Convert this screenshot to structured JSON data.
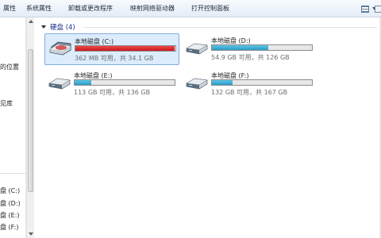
{
  "toolbar": {
    "items": [
      "属性",
      "系统属性",
      "卸载或更改程序",
      "映射网络驱动器",
      "打开控制面板"
    ]
  },
  "nav": {
    "items": [
      {
        "label": "的位置"
      },
      {
        "label": "见库"
      },
      {
        "label": "盘 (C:)"
      },
      {
        "label": "盘 (D:)"
      },
      {
        "label": "盘 (E:)"
      },
      {
        "label": "盘 (F:)"
      }
    ]
  },
  "group": {
    "title": "硬盘 (4)"
  },
  "drives": [
    {
      "name": "本地磁盘 (C:)",
      "space": "362 MB 可用，共 34.1 GB",
      "used_fraction": 0.99,
      "critical": true,
      "selected": true
    },
    {
      "name": "本地磁盘 (D:)",
      "space": "54.9 GB 可用，共 126 GB",
      "used_fraction": 0.56,
      "critical": false,
      "selected": false
    },
    {
      "name": "本地磁盘 (E:)",
      "space": "113 GB 可用，共 136 GB",
      "used_fraction": 0.17,
      "critical": false,
      "selected": false
    },
    {
      "name": "本地磁盘 (F:)",
      "space": "132 GB 可用，共 167 GB",
      "used_fraction": 0.21,
      "critical": false,
      "selected": false
    }
  ],
  "colors": {
    "bar_normal": "#2a9bc8",
    "bar_critical": "#c8181c",
    "selection_bg": "#dcecfc",
    "group_title": "#1e3287"
  }
}
